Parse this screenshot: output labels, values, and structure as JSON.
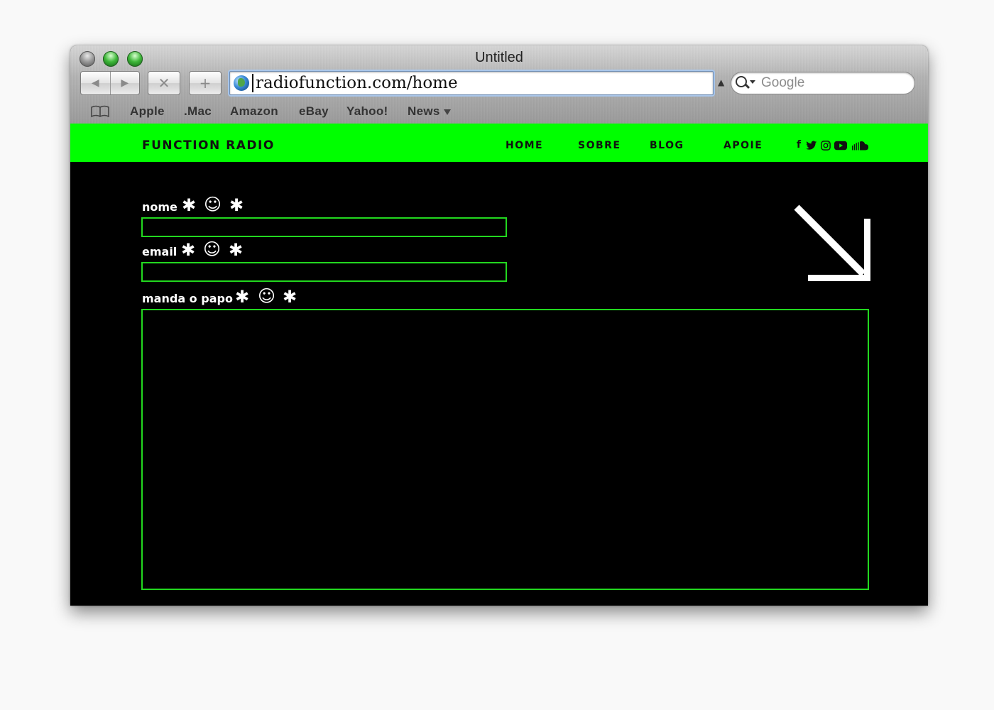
{
  "browser": {
    "window_title": "Untitled",
    "url": "radiofunction.com/home",
    "search_placeholder": "Google",
    "bookmarks": [
      "Apple",
      ".Mac",
      "Amazon",
      "eBay",
      "Yahoo!",
      "News"
    ]
  },
  "site": {
    "logo": "FUNCTION RADIO",
    "nav": [
      "HOME",
      "SOBRE",
      "BLOG",
      "APOIE"
    ],
    "social_icons": [
      "facebook-icon",
      "twitter-icon",
      "instagram-icon",
      "youtube-icon",
      "soundcloud-icon"
    ],
    "accent_color": "#00ff00",
    "field_border_color": "#22d81f"
  },
  "form": {
    "name_label": "nome",
    "email_label": "email",
    "message_label": "manda o papo",
    "name_value": "",
    "email_value": "",
    "message_value": "",
    "deco": {
      "asterisk": "✱",
      "smiley": "☺"
    }
  }
}
